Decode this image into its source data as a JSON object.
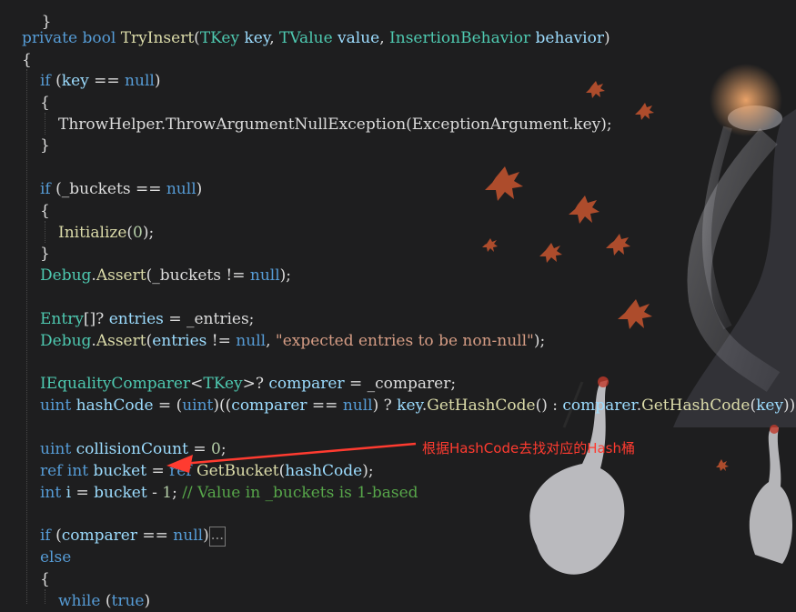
{
  "code": {
    "top_brace": "}",
    "method_signature": {
      "modifiers": "private bool ",
      "name": "TryInsert",
      "open": "(",
      "p1_type": "TKey",
      "p1_name": " key",
      "sep1": ", ",
      "p2_type": "TValue",
      "p2_name": " value",
      "sep2": ", ",
      "p3_type": "InsertionBehavior",
      "p3_name": " behavior",
      "close": ")"
    },
    "open_brace": "{",
    "if_key": {
      "kw": "if",
      "open": " (",
      "var": "key",
      "op": " == ",
      "null": "null",
      "close": ")"
    },
    "brace1_open": "{",
    "throw": {
      "cls": "ThrowHelper",
      "dot": ".",
      "method": "ThrowArgumentNullException",
      "open": "(",
      "arg_cls": "ExceptionArgument",
      "arg": ".key",
      "close": ");"
    },
    "brace1_close": "}",
    "if_buckets": {
      "kw": "if",
      "open": " (",
      "var": "_buckets",
      "op": " == ",
      "null": "null",
      "close": ")"
    },
    "brace2_open": "{",
    "initialize": {
      "method": "Initialize",
      "open": "(",
      "num": "0",
      "close": ");"
    },
    "brace2_close": "}",
    "assert1": {
      "cls": "Debug",
      "dot": ".",
      "method": "Assert",
      "open": "(",
      "var": "_buckets",
      "op": " != ",
      "null": "null",
      "close": ");"
    },
    "entries_decl": {
      "type": "Entry",
      "rest": "[]? ",
      "var": "entries",
      "assign": " = _entries;"
    },
    "assert2": {
      "cls": "Debug",
      "dot": ".",
      "method": "Assert",
      "open": "(",
      "var": "entries",
      "op": " != ",
      "null": "null",
      "comma": ", ",
      "str": "\"expected entries to be non-null\"",
      "close": ");"
    },
    "comparer_decl": {
      "type": "IEqualityComparer",
      "lt": "<",
      "targ": "TKey",
      "gt": ">? ",
      "var": "comparer",
      "assign": " = _comparer;"
    },
    "hashcode_decl": {
      "kw": "uint",
      "var": " hashCode",
      "eq": " = (",
      "cast": "uint",
      "p1": ")((",
      "v1": "comparer",
      "op": " == ",
      "null": "null",
      "p2": ") ? ",
      "v2": "key",
      "dot1": ".",
      "m1": "GetHashCode",
      "p3": "() : ",
      "v3": "comparer",
      "dot2": ".",
      "m2": "GetHashCode",
      "p4": "(",
      "v4": "key",
      "p5": "));"
    },
    "collision_decl": {
      "kw": "uint",
      "var": " collisionCount",
      "assign": " = ",
      "num": "0",
      "end": ";"
    },
    "bucket_decl": {
      "kw1": "ref",
      "kw2": " int",
      "var": " bucket",
      "assign": " = ",
      "kw3": "ref",
      "method": " GetBucket",
      "open": "(",
      "arg": "hashCode",
      "close": ");"
    },
    "i_decl": {
      "kw": "int",
      "var": " i",
      "assign": " = ",
      "v2": "bucket",
      "minus": " - ",
      "num": "1",
      "end": "; ",
      "comment": "// Value in _buckets is 1-based"
    },
    "if_comparer": {
      "kw": "if",
      "open": " (",
      "var": "comparer",
      "op": " == ",
      "null": "null",
      "close": ")",
      "collapsed": "..."
    },
    "else": "else",
    "brace3_open": "{",
    "while": {
      "kw": "while",
      "open": " (",
      "val": "true",
      "close": ")"
    }
  },
  "annotation": {
    "text": "根据HashCode去找对应的Hash桶",
    "color": "#ff3b30"
  }
}
